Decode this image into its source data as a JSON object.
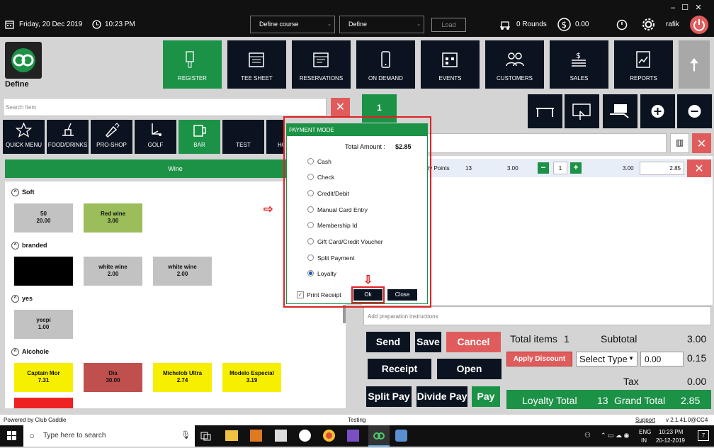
{
  "topbar": {
    "date": "Friday, 20 Dec 2019",
    "time": "10:23 PM",
    "course_select": "Define  course",
    "define_select": "Define",
    "load_label": "Load",
    "rounds": "0 Rounds",
    "amount": "0.00",
    "user": "rafik"
  },
  "brand": {
    "name": "Define"
  },
  "nav": {
    "register": "REGISTER",
    "tee_sheet": "TEE SHEET",
    "reservations": "RESERVATIONS",
    "on_demand": "ON DEMAND",
    "events": "EVENTS",
    "customers": "CUSTOMERS",
    "sales": "SALES",
    "reports": "REPORTS"
  },
  "search": {
    "placeholder": "Search Item"
  },
  "categories": {
    "quick_menu": "QUICK MENU",
    "food_drinks": "FOOD/DRINKS",
    "pro_shop": "PRO-SHOP",
    "golf": "GOLF",
    "bar": "BAR",
    "test": "TEST",
    "ho": "HO"
  },
  "subcategory": "Wine",
  "sections": {
    "soft": "Soft",
    "branded": "branded",
    "yes": "yes",
    "alcohole": "Alcohole"
  },
  "items": [
    {
      "name": "50",
      "price": "20.00"
    },
    {
      "name": "Red wine",
      "price": "3.00"
    },
    {
      "name": "white wine",
      "price": "2.00"
    },
    {
      "name": "white wine",
      "price": "2.00"
    },
    {
      "name": "yeepi",
      "price": "1.00"
    },
    {
      "name": "Captain Mor",
      "price": "7.31"
    },
    {
      "name": "Dia",
      "price": "30.00"
    },
    {
      "name": "Michelob Ultra",
      "price": "2.74"
    },
    {
      "name": "Modelo Especial",
      "price": "3.19"
    }
  ],
  "order": {
    "tab_number": "1",
    "line": {
      "points_label": "ty Points",
      "points": "13",
      "unit_price": "3.00",
      "qty": "1",
      "total": "3.00",
      "price_field": "2.85"
    },
    "prep_placeholder": "Add preparation instructions"
  },
  "actions": {
    "send": "Send",
    "save": "Save",
    "cancel": "Cancel",
    "receipt": "Receipt",
    "open": "Open",
    "split_pay": "Split Pay",
    "divide_pay": "Divide Pay",
    "pay": "Pay"
  },
  "totals": {
    "total_items_label": "Total items",
    "total_items": "1",
    "subtotal_label": "Subtotal",
    "subtotal": "3.00",
    "apply_discount": "Apply Discount",
    "select_type": "Select Type",
    "discount_input": "0.00",
    "discount": "0.15",
    "tax_label": "Tax",
    "tax": "0.00",
    "loyalty_label": "Loyalty Total",
    "loyalty": "13",
    "grand_label": "Grand Total",
    "grand": "2.85"
  },
  "dialog": {
    "title": "PAYMENT MODE",
    "total_label": "Total Amount :",
    "total_value": "$2.85",
    "options": [
      "Cash",
      "Check",
      "Credit/Debit",
      "Manual Card Entry",
      "Membership Id",
      "Gift Card/Credit Voucher",
      "Split Payment",
      "Loyalty"
    ],
    "selected": "Loyalty",
    "print_receipt": "Print Receipt",
    "ok": "Ok",
    "close": "Close"
  },
  "footer": {
    "powered": "Powered by Club Caddie",
    "env": "Testing",
    "support": "Support",
    "version": "v 2.1.41.0@CC4"
  },
  "taskbar": {
    "search_placeholder": "Type here to search",
    "lang": "ENG",
    "region": "IN",
    "clock": "10:23 PM",
    "date": "20-12-2019",
    "notif_count": "7"
  },
  "colors": {
    "accent_green": "#1c9247",
    "danger_red": "#e05c5c",
    "dark_navy": "#0b1320",
    "highlight_red": "#dd2222"
  }
}
